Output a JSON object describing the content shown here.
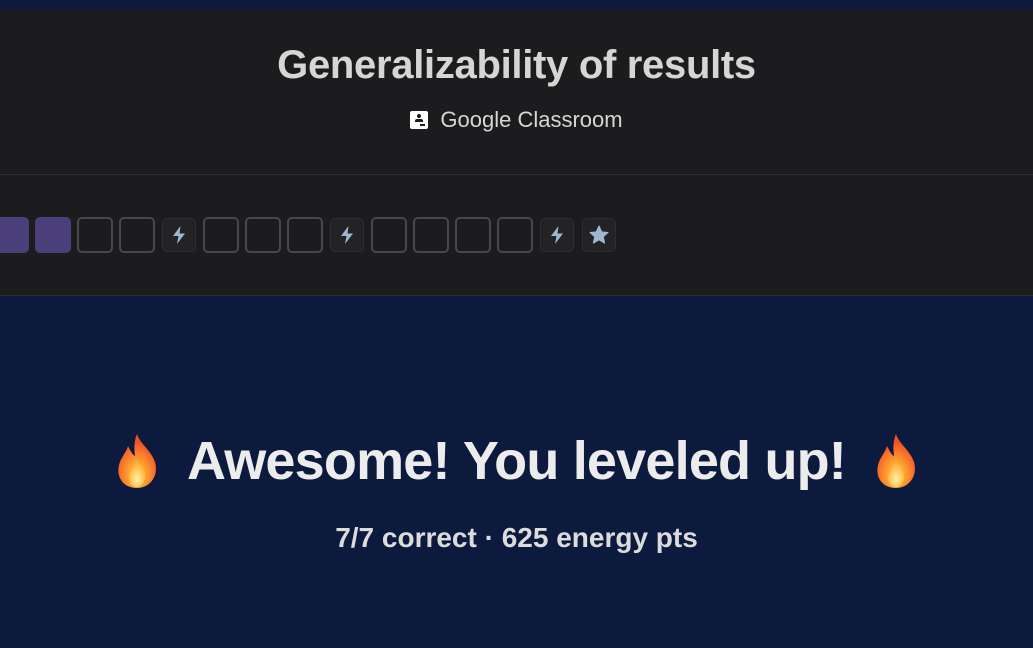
{
  "header": {
    "title": "Generalizability of results",
    "classroom_label": "Google Classroom"
  },
  "progress": {
    "cells": [
      {
        "kind": "filled"
      },
      {
        "kind": "filled"
      },
      {
        "kind": "empty"
      },
      {
        "kind": "empty"
      },
      {
        "kind": "bolt",
        "icon": "lightning-icon"
      },
      {
        "kind": "empty"
      },
      {
        "kind": "empty"
      },
      {
        "kind": "empty"
      },
      {
        "kind": "bolt",
        "icon": "lightning-icon"
      },
      {
        "kind": "empty"
      },
      {
        "kind": "empty"
      },
      {
        "kind": "empty"
      },
      {
        "kind": "empty"
      },
      {
        "kind": "bolt",
        "icon": "lightning-icon"
      },
      {
        "kind": "star",
        "icon": "star-icon"
      }
    ],
    "filled_color": "#4a3f7a"
  },
  "result": {
    "headline": "Awesome! You leveled up!",
    "summary": "7/7 correct · 625 energy pts",
    "left_icon": "fire-icon",
    "right_icon": "fire-icon"
  },
  "colors": {
    "page_background": "#0b1a3d",
    "header_background": "#1c1c1e",
    "text_primary": "#ececec",
    "icon_color": "#9fb6cf"
  }
}
